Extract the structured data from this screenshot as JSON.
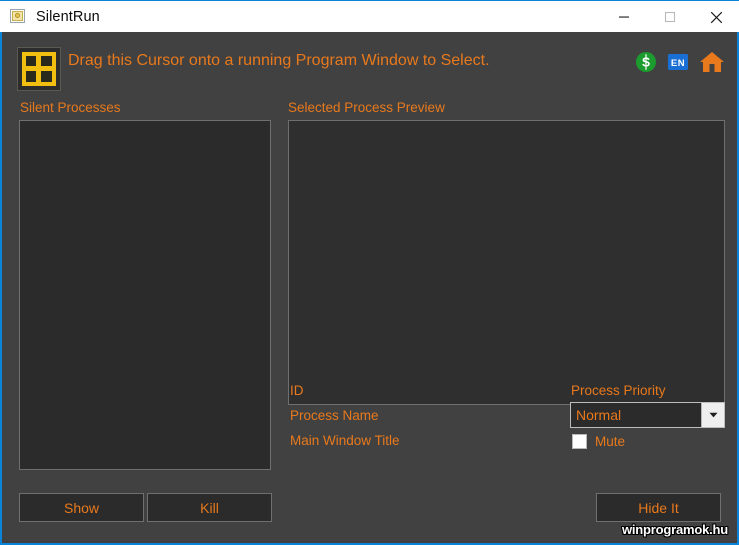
{
  "window": {
    "title": "SilentRun",
    "icon": "application-window-icon",
    "controls": {
      "minimize": "Minimize",
      "maximize": "Maximize",
      "close": "Close"
    },
    "border_color": "#0a84d8",
    "background_color": "#414141"
  },
  "header": {
    "cursor_icon": "window-target-cursor-icon",
    "instruction": "Drag this Cursor onto a running Program Window to Select.",
    "accent_color": "#e8791c"
  },
  "top_icons": [
    {
      "name": "donate-icon",
      "label": "$",
      "color": "#1c9b2e"
    },
    {
      "name": "language-icon",
      "label": "EN",
      "color": "#1a6fd4"
    },
    {
      "name": "home-icon",
      "label": "",
      "color": "#e8791c"
    }
  ],
  "panels": {
    "silent_processes": {
      "label": "Silent Processes",
      "items": []
    },
    "selected_preview": {
      "label": "Selected Process Preview",
      "content": ""
    }
  },
  "details": {
    "id_label": "ID",
    "id_value": "",
    "process_name_label": "Process Name",
    "process_name_value": "",
    "main_window_title_label": "Main Window Title",
    "main_window_title_value": ""
  },
  "priority": {
    "label": "Process Priority",
    "selected": "Normal",
    "options": [
      "Normal"
    ]
  },
  "mute": {
    "label": "Mute",
    "checked": false
  },
  "buttons": {
    "show": "Show",
    "kill": "Kill",
    "hide_it": "Hide It"
  },
  "watermark": "winprogramok.hu"
}
